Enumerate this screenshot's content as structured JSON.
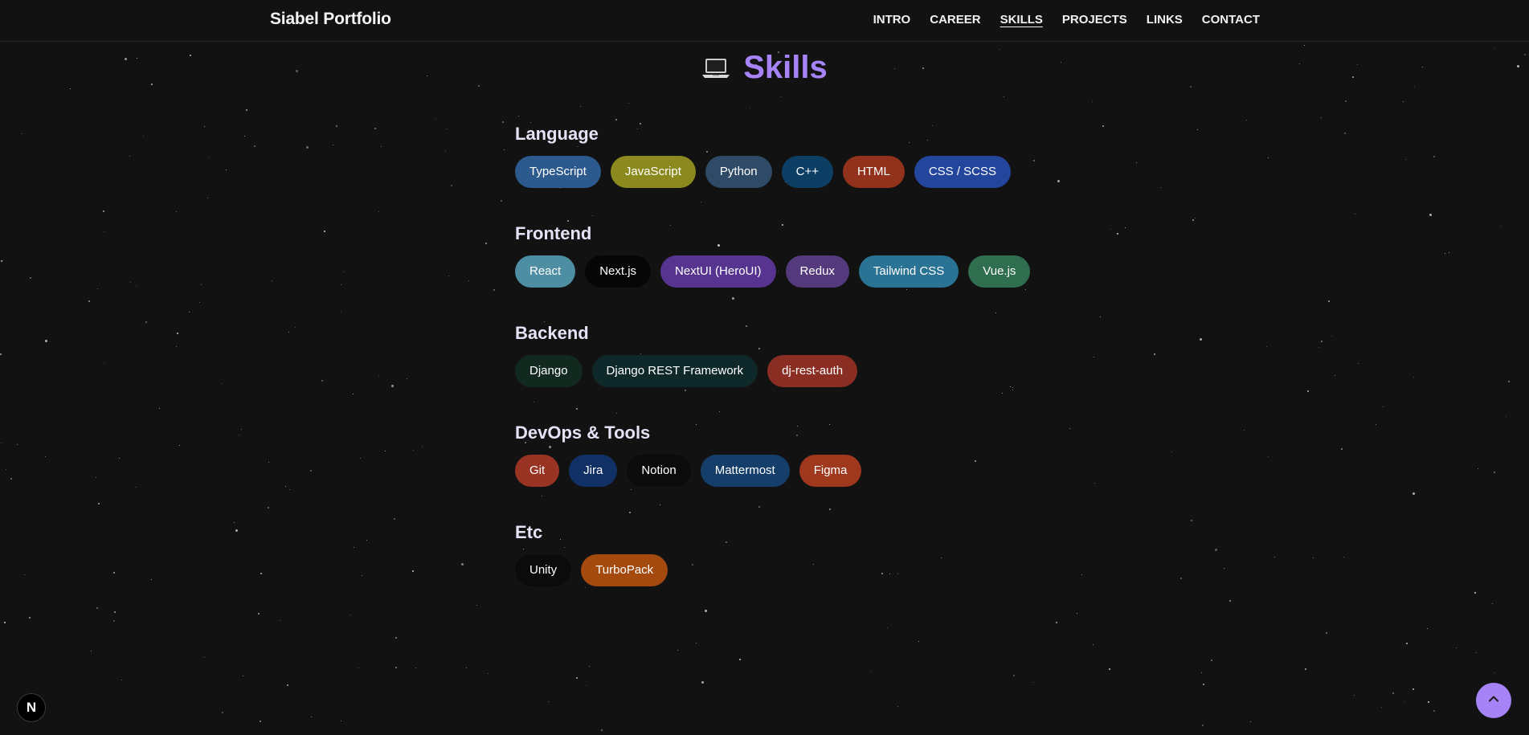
{
  "header": {
    "brand": "Siabel Portfolio",
    "nav": [
      {
        "label": "INTRO",
        "active": false
      },
      {
        "label": "CAREER",
        "active": false
      },
      {
        "label": "SKILLS",
        "active": true
      },
      {
        "label": "PROJECTS",
        "active": false
      },
      {
        "label": "LINKS",
        "active": false
      },
      {
        "label": "CONTACT",
        "active": false
      }
    ]
  },
  "section": {
    "icon": "laptop-icon",
    "title": "Skills"
  },
  "categories": [
    {
      "title": "Language",
      "skills": [
        {
          "label": "TypeScript",
          "color": "#2c5a8e"
        },
        {
          "label": "JavaScript",
          "color": "#8c8a1e"
        },
        {
          "label": "Python",
          "color": "#2e4a66"
        },
        {
          "label": "C++",
          "color": "#0d3f64"
        },
        {
          "label": "HTML",
          "color": "#92321d"
        },
        {
          "label": "CSS / SCSS",
          "color": "#23459b"
        }
      ]
    },
    {
      "title": "Frontend",
      "skills": [
        {
          "label": "React",
          "color": "#4d8ea3"
        },
        {
          "label": "Next.js",
          "color": "#060606"
        },
        {
          "label": "NextUI (HeroUI)",
          "color": "#56348f"
        },
        {
          "label": "Redux",
          "color": "#543a7d"
        },
        {
          "label": "Tailwind CSS",
          "color": "#2a7394"
        },
        {
          "label": "Vue.js",
          "color": "#2f6e4f"
        }
      ]
    },
    {
      "title": "Backend",
      "skills": [
        {
          "label": "Django",
          "color": "#12291f"
        },
        {
          "label": "Django REST Framework",
          "color": "#0f2829"
        },
        {
          "label": "dj-rest-auth",
          "color": "#8a2e24"
        }
      ]
    },
    {
      "title": "DevOps & Tools",
      "skills": [
        {
          "label": "Git",
          "color": "#993323"
        },
        {
          "label": "Jira",
          "color": "#113066"
        },
        {
          "label": "Notion",
          "color": "#0b0b0b"
        },
        {
          "label": "Mattermost",
          "color": "#163e6b"
        },
        {
          "label": "Figma",
          "color": "#a0381e"
        }
      ]
    },
    {
      "title": "Etc",
      "skills": [
        {
          "label": "Unity",
          "color": "#0b0b0b"
        },
        {
          "label": "TurboPack",
          "color": "#a44a0f"
        }
      ]
    }
  ],
  "floating": {
    "next_badge": "N",
    "next_icon": "nextjs-logo-icon",
    "scroll_top_icon": "chevron-up-icon",
    "accent_color": "#a683f7"
  }
}
